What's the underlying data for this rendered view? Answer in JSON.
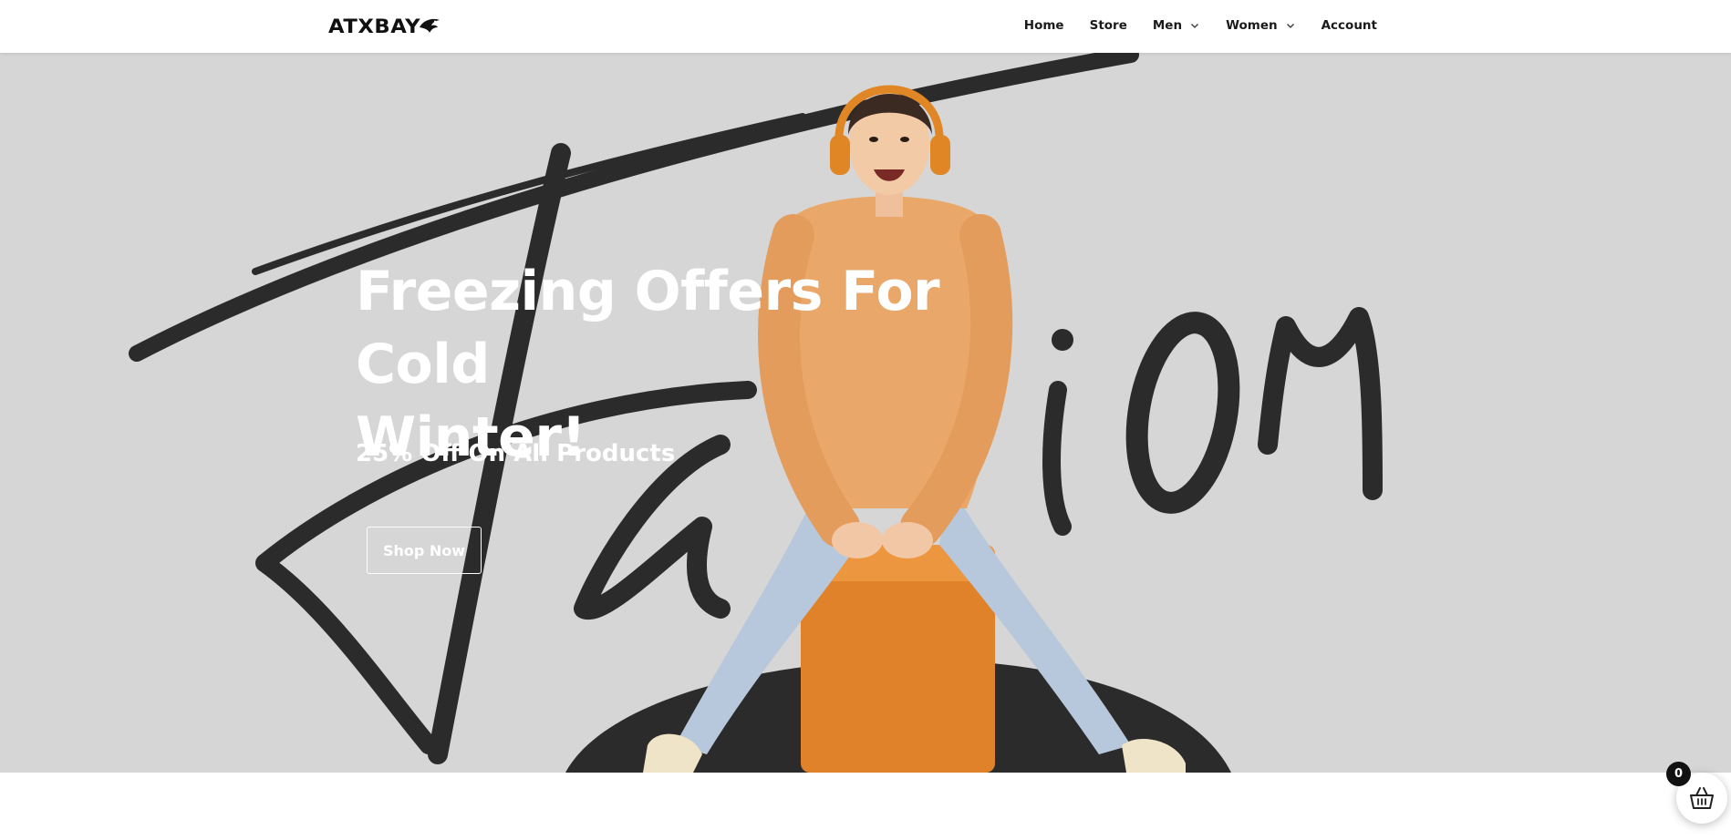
{
  "brand": {
    "name": "ATXBAY"
  },
  "nav": {
    "items": [
      {
        "label": "Home",
        "has_dropdown": false
      },
      {
        "label": "Store",
        "has_dropdown": false
      },
      {
        "label": "Men",
        "has_dropdown": true
      },
      {
        "label": "Women",
        "has_dropdown": true
      },
      {
        "label": "Account",
        "has_dropdown": false
      }
    ]
  },
  "hero": {
    "title_line1": "Freezing Offers For Cold",
    "title_line2": "Winter!",
    "subtitle": "25% Off On All Products",
    "button_label": "Shop Now",
    "backdrop_word": "Fashion",
    "image_subject": "woman in orange hoodie and headphones sitting on orange stool"
  },
  "cart": {
    "count": "0",
    "icon": "basket-icon"
  },
  "colors": {
    "hero_bg": "#d6d6d6",
    "script_ink": "#2b2b2b",
    "accent_orange": "#e8892c",
    "text_white": "#ffffff"
  }
}
